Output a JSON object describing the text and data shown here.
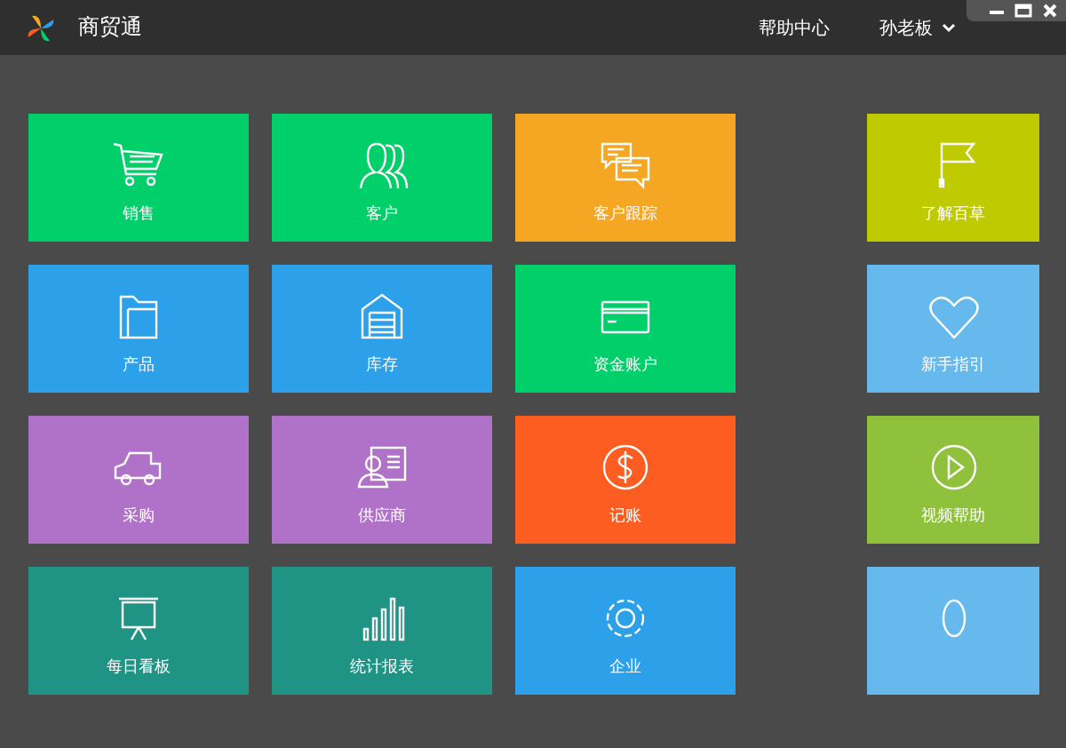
{
  "app": {
    "title": "商贸通"
  },
  "header": {
    "help": "帮助中心",
    "user": "孙老板"
  },
  "main_tiles": [
    {
      "label": "销售",
      "color": "#00cf6a"
    },
    {
      "label": "客户",
      "color": "#00cf6a"
    },
    {
      "label": "客户跟踪",
      "color": "#f5a623"
    },
    {
      "label": "产品",
      "color": "#2ca0e8"
    },
    {
      "label": "库存",
      "color": "#2ca0e8"
    },
    {
      "label": "资金账户",
      "color": "#00cf6a"
    },
    {
      "label": "采购",
      "color": "#b071c8"
    },
    {
      "label": "供应商",
      "color": "#b071c8"
    },
    {
      "label": "记账",
      "color": "#fe5d21"
    },
    {
      "label": "每日看板",
      "color": "#1f9384"
    },
    {
      "label": "统计报表",
      "color": "#1f9384"
    },
    {
      "label": "企业",
      "color": "#2ca0e8"
    }
  ],
  "side_tiles": [
    {
      "label": "了解百草",
      "color": "#bfcb00"
    },
    {
      "label": "新手指引",
      "color": "#66b9ec"
    },
    {
      "label": "视频帮助",
      "color": "#8fc13c"
    },
    {
      "color": "#66b9ec"
    }
  ]
}
